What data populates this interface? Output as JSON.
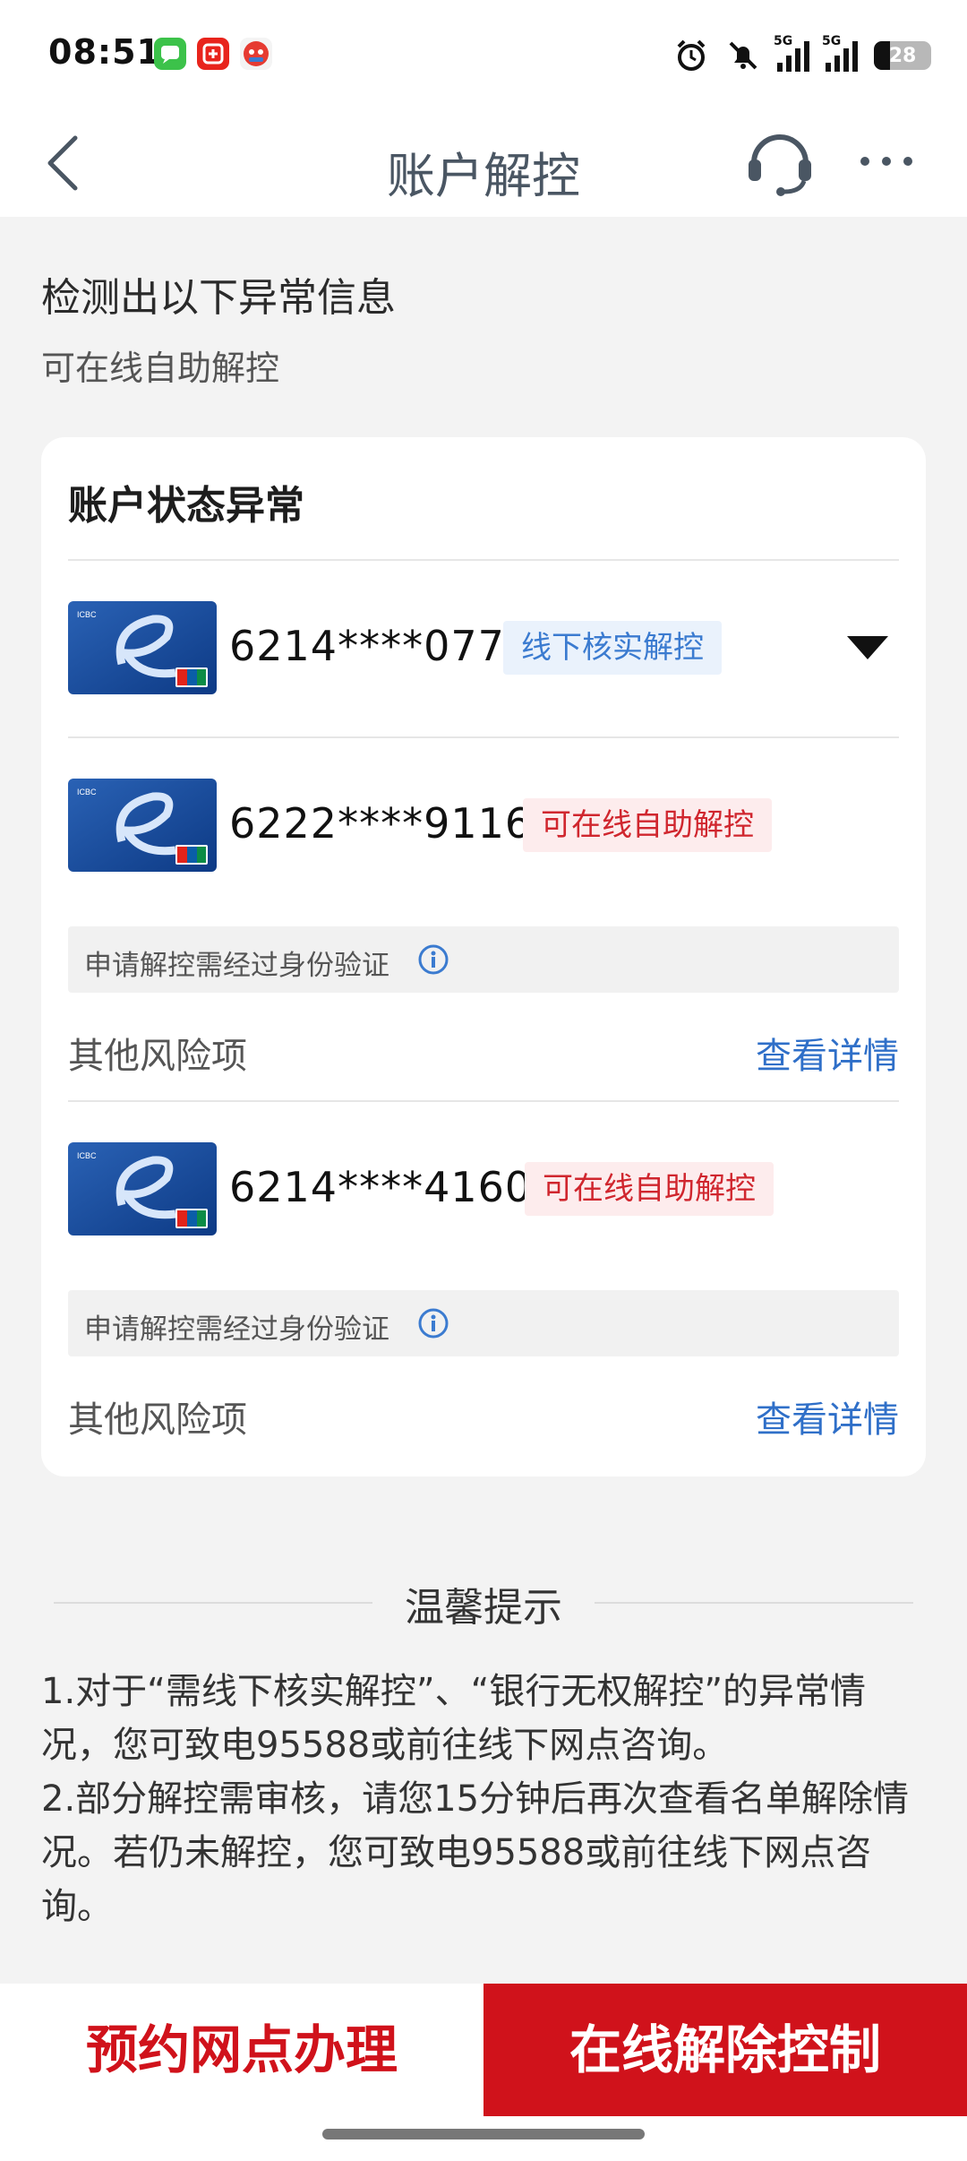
{
  "status_bar": {
    "time": "08:51",
    "signal1_label": "5G",
    "signal2_label": "5G",
    "battery": "28",
    "icons": [
      "message-app-icon",
      "taobao-app-icon",
      "red-app-icon",
      "alarm-icon",
      "mute-bell-icon",
      "signal-icon",
      "battery-icon"
    ]
  },
  "nav": {
    "title": "账户解控",
    "icons": [
      "back-arrow-icon",
      "headset-icon",
      "more-icon"
    ]
  },
  "intro": {
    "title": "检测出以下异常信息",
    "subtitle": "可在线自助解控"
  },
  "card": {
    "title": "账户状态异常",
    "accounts": [
      {
        "number": "6214****0770",
        "badge": "线下核实解控",
        "badge_color": "#3b7bd0"
      },
      {
        "number": "6222****9116",
        "badge": "可在线自助解控",
        "badge_color": "#d0262e",
        "verify_note": "申请解控需经过身份验证",
        "risk_label": "其他风险项",
        "risk_link": "查看详情"
      },
      {
        "number": "6214****4160",
        "badge": "可在线自助解控",
        "badge_color": "#d0262e",
        "verify_note": "申请解控需经过身份验证",
        "risk_label": "其他风险项",
        "risk_link": "查看详情"
      }
    ]
  },
  "tips": {
    "title": "温馨提示",
    "items": [
      "1.对于“需线下核实解控”、“银行无权解控”的异常情况，您可致电95588或前往线下网点咨询。",
      "2.部分解控需审核，请您15分钟后再次查看名单解除情况。若仍未解控，您可致电95588或前往线下网点咨询。"
    ]
  },
  "bottom": {
    "appoint_label": "预约网点办理",
    "online_label": "在线解除控制"
  },
  "colors": {
    "brand_red": "#d0121b",
    "link_blue": "#2f6fc8",
    "background": "#f3f3f3"
  }
}
